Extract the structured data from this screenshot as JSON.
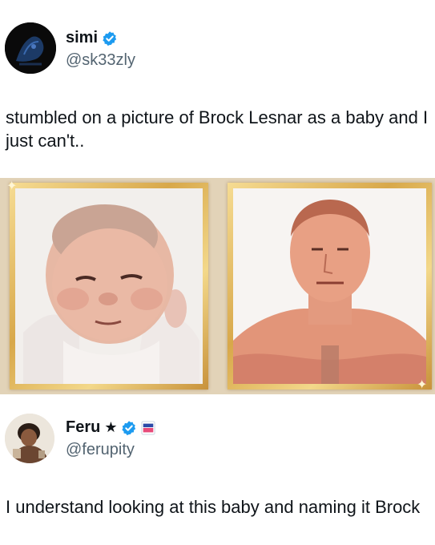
{
  "tweet1": {
    "display_name": "simi",
    "handle": "@sk33zly",
    "text": "stumbled on a picture of Brock Lesnar as a baby and I just can't.."
  },
  "tweet2": {
    "display_name": "Feru",
    "name_suffix": "★",
    "handle": "@ferupity",
    "text": "I understand looking at this baby and naming it Brock"
  },
  "colors": {
    "verified_blue": "#1d9bf0",
    "handle_gray": "#536471",
    "frame_gold": "#d8a84a"
  },
  "icons": [
    "verified-badge-icon",
    "star-icon",
    "affiliate-badge-icon"
  ]
}
